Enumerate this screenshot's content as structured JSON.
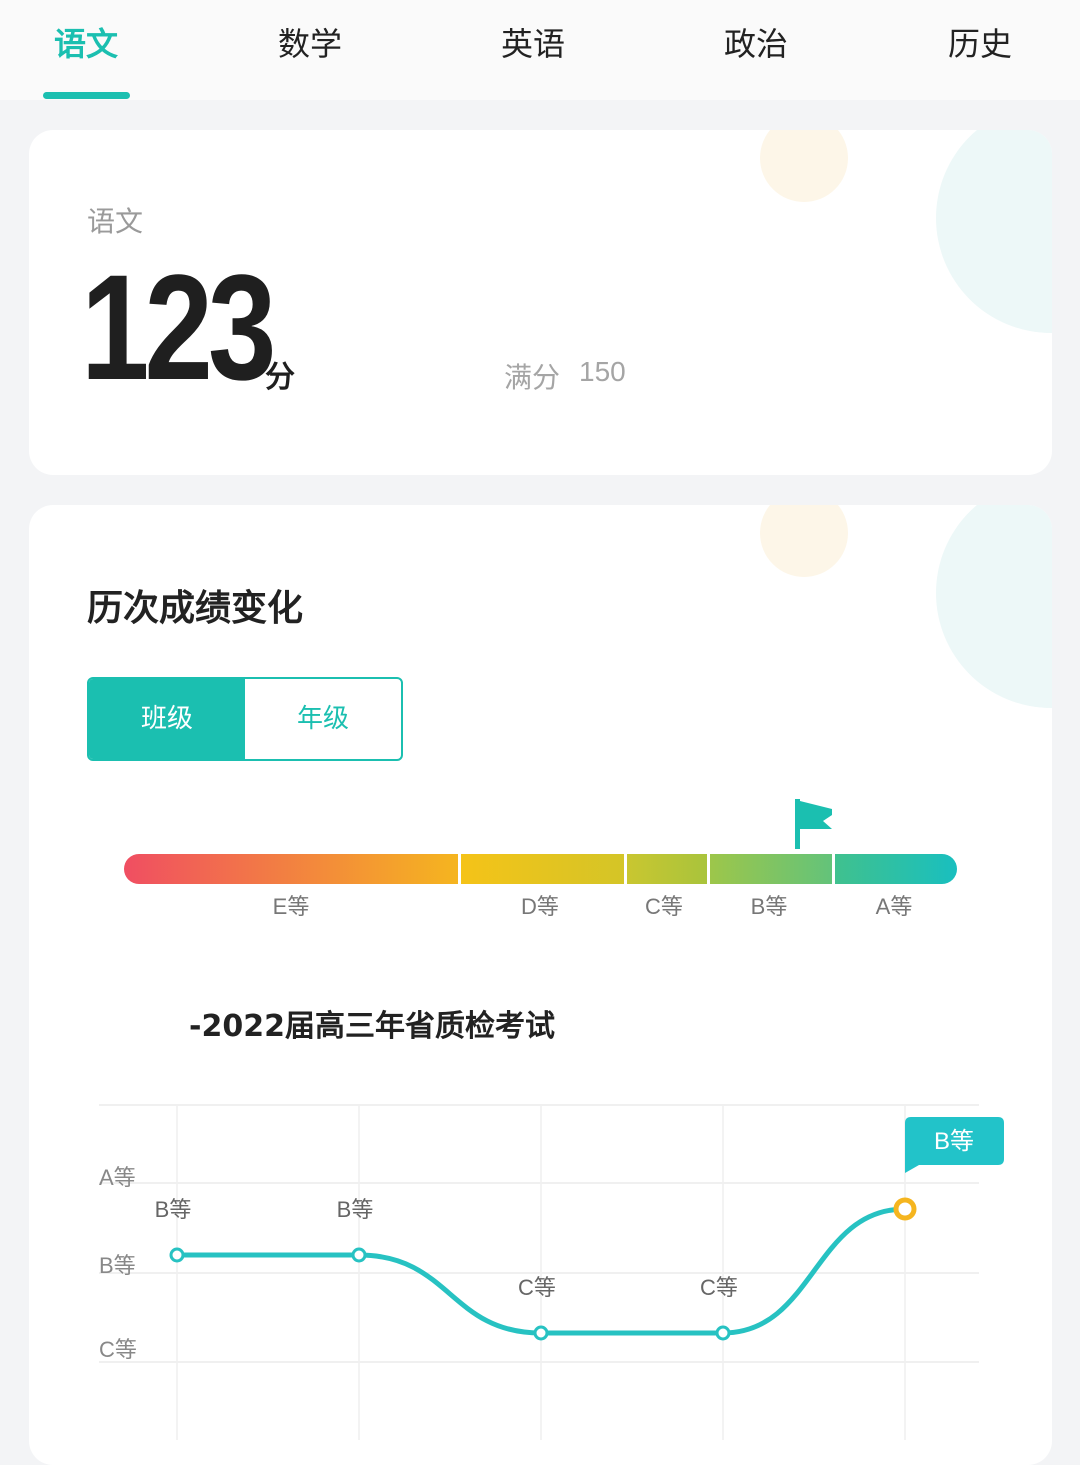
{
  "tabs": [
    {
      "label": "语文",
      "active": true
    },
    {
      "label": "数学"
    },
    {
      "label": "英语"
    },
    {
      "label": "政治"
    },
    {
      "label": "历史"
    }
  ],
  "score_card": {
    "subject": "语文",
    "score": "123",
    "unit": "分",
    "full_label": "满分",
    "full_value": "150"
  },
  "trend": {
    "title": "历次成绩变化",
    "toggle": {
      "class_label": "班级",
      "grade_label": "年级"
    },
    "grade_bar": {
      "segments": [
        {
          "label": "E等",
          "color_from": "#f04e62",
          "color_to": "#f5b51f"
        },
        {
          "label": "D等",
          "color_from": "#f5c318",
          "color_to": "#d4c527"
        },
        {
          "label": "C等",
          "color_from": "#c9c630",
          "color_to": "#a9c43c"
        },
        {
          "label": "B等",
          "color_from": "#9dc64a",
          "color_to": "#63c37a"
        },
        {
          "label": "A等",
          "color_from": "#40c18e",
          "color_to": "#19bfbf"
        }
      ],
      "current_segment": "B等"
    },
    "exam_title": "-2022届高三年省质检考试"
  },
  "chart_data": {
    "type": "line",
    "y_categories": [
      "C等",
      "B等",
      "A等"
    ],
    "y_labels_visible": [
      "A等",
      "B等",
      "C等"
    ],
    "points": [
      {
        "x": 1,
        "grade": "B等"
      },
      {
        "x": 2,
        "grade": "B等"
      },
      {
        "x": 3,
        "grade": "C等"
      },
      {
        "x": 4,
        "grade": "C等"
      },
      {
        "x": 5,
        "grade": "B等",
        "highlight": true
      }
    ],
    "callout_label": "B等",
    "line_color": "#27c2c2",
    "highlight_color": "#f5b51f",
    "grid": true
  },
  "colors": {
    "accent": "#1bbfb0"
  }
}
